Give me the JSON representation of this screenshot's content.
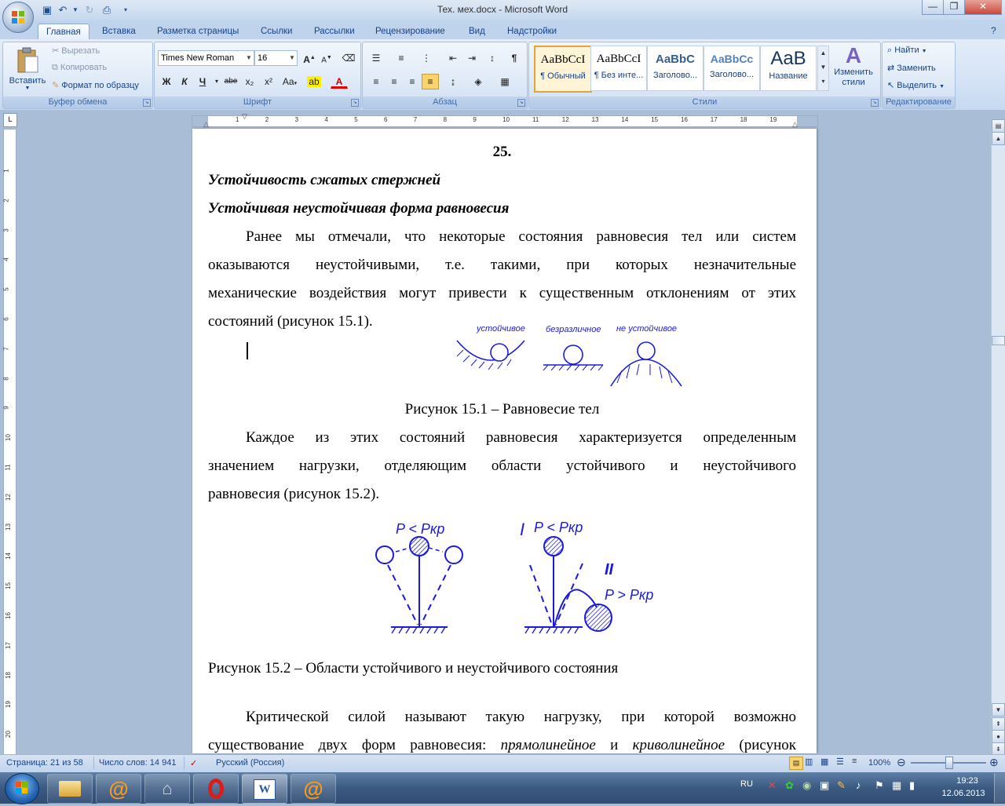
{
  "window": {
    "title": "Тех. мех.docx - Microsoft Word",
    "minimize": "—",
    "maximize": "❐",
    "close": "✕"
  },
  "tabs": [
    "Главная",
    "Вставка",
    "Разметка страницы",
    "Ссылки",
    "Рассылки",
    "Рецензирование",
    "Вид",
    "Надстройки"
  ],
  "ribbon": {
    "clipboard": {
      "label": "Буфер обмена",
      "paste": "Вставить",
      "cut": "Вырезать",
      "copy": "Копировать",
      "format_painter": "Формат по образцу"
    },
    "font": {
      "label": "Шрифт",
      "font_name": "Times New Roman",
      "font_size": "16",
      "bold": "Ж",
      "italic": "К",
      "underline": "Ч",
      "strike": "abe",
      "subscript": "x₂",
      "superscript": "x²",
      "change_case": "Aa",
      "grow": "A",
      "shrink": "A"
    },
    "paragraph": {
      "label": "Абзац"
    },
    "styles": {
      "label": "Стили",
      "items": [
        {
          "sample": "AaBbCcI",
          "name": "¶ Обычный"
        },
        {
          "sample": "AaBbCcI",
          "name": "¶ Без инте..."
        },
        {
          "sample": "AaBbC",
          "name": "Заголово..."
        },
        {
          "sample": "AaBbCc",
          "name": "Заголово..."
        },
        {
          "sample": "AaB",
          "name": "Название"
        }
      ],
      "change_styles": "Изменить стили"
    },
    "editing": {
      "label": "Редактирование",
      "find": "Найти",
      "replace": "Заменить",
      "select": "Выделить"
    }
  },
  "document": {
    "page_number": "25.",
    "heading1": "Устойчивость сжатых стержней",
    "heading2": "Устойчивая неустойчивая форма равновесия",
    "p1_l1": "Ранее мы отмечали, что некоторые состояния равновесия тел или систем",
    "p1_l2": "оказываются неустойчивыми, т.е. такими, при которых незначительные",
    "p1_l3": "механические воздействия могут привести к существенным отклонениям от этих",
    "p1_l4": "состояний (рисунок 15.1).",
    "fig1_labels": [
      "устойчивое",
      "безразличное",
      "не устойчивое"
    ],
    "fig1_caption": "Рисунок 15.1 – Равновесие тел",
    "p2_l1": "Каждое из этих состояний равновесия характеризуется определенным",
    "p2_l2": "значением нагрузки, отделяющим области устойчивого и неустойчивого",
    "p2_l3": "равновесия (рисунок 15.2).",
    "fig2": {
      "label_left": "P < Pкр",
      "label_mid": "P < Pкр",
      "mark_I": "I",
      "mark_II": "II",
      "label_right": "P > Pкр"
    },
    "fig2_caption": "Рисунок 15.2 – Области устойчивого и неустойчивого состояния",
    "p3_l1": "Критической силой называют такую нагрузку, при которой возможно",
    "p3_l2_a": "существование двух форм равновесия: ",
    "p3_l2_b": "прямолинейное",
    "p3_l2_c": " и ",
    "p3_l2_d": "криволинейное",
    "p3_l2_e": " (рисунок"
  },
  "ruler": {
    "h_numbers": [
      "1",
      "2",
      "3",
      "4",
      "5",
      "6",
      "7",
      "8",
      "9",
      "10",
      "11",
      "12",
      "13",
      "14",
      "15",
      "16",
      "17",
      "18",
      "19"
    ],
    "v_numbers": [
      "1",
      "2",
      "3",
      "4",
      "5",
      "6",
      "7",
      "8",
      "9",
      "10",
      "11",
      "12",
      "13",
      "14",
      "15",
      "16",
      "17",
      "18",
      "19",
      "20"
    ]
  },
  "status": {
    "page": "Страница: 21 из 58",
    "words": "Число слов: 14 941",
    "language": "Русский (Россия)",
    "zoom": "100%"
  },
  "taskbar": {
    "lang": "RU",
    "time": "19:23",
    "date": "12.06.2013"
  },
  "colors": {
    "figure_blue": "#1a1adf",
    "ribbon_text": "#15428b",
    "opera_red": "#d81d1d"
  }
}
